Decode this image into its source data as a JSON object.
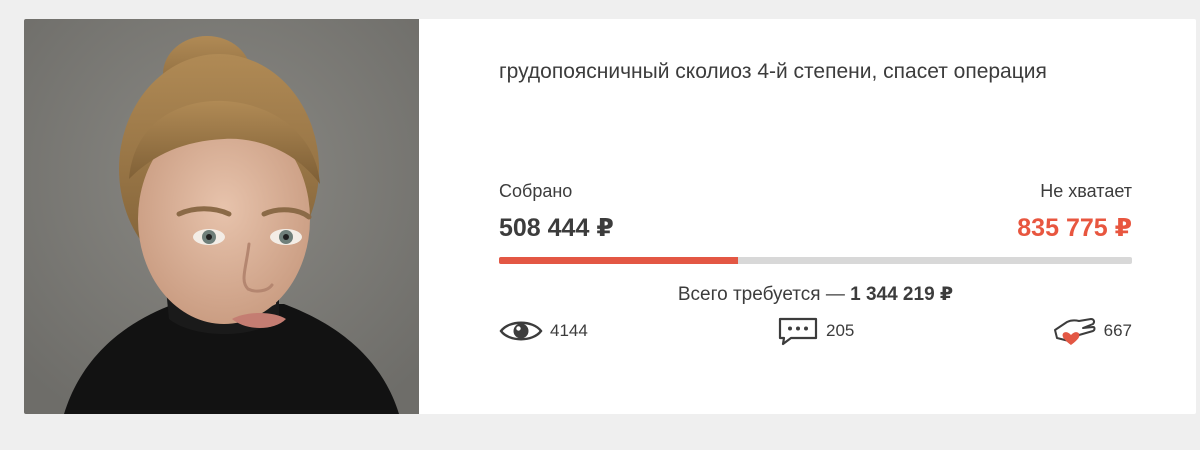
{
  "card": {
    "title": "грудопоясничный сколиоз 4-й степени, спасет операция",
    "collected_label": "Собрано",
    "collected_amount": "508 444 ₽",
    "missing_label": "Не хватает",
    "missing_amount": "835 775 ₽",
    "progress_fraction": 0.378,
    "total_prefix": "Всего требуется — ",
    "total_amount": "1 344 219 ₽",
    "colors": {
      "accent": "#e35744",
      "missing": "#e8563f",
      "text": "#3c3c3c",
      "track": "#d8d8d8"
    }
  },
  "stats": {
    "views": {
      "icon": "eye-icon",
      "count": "4144"
    },
    "comments": {
      "icon": "comment-icon",
      "count": "205"
    },
    "helpers": {
      "icon": "helping-hand-heart-icon",
      "count": "667"
    }
  }
}
